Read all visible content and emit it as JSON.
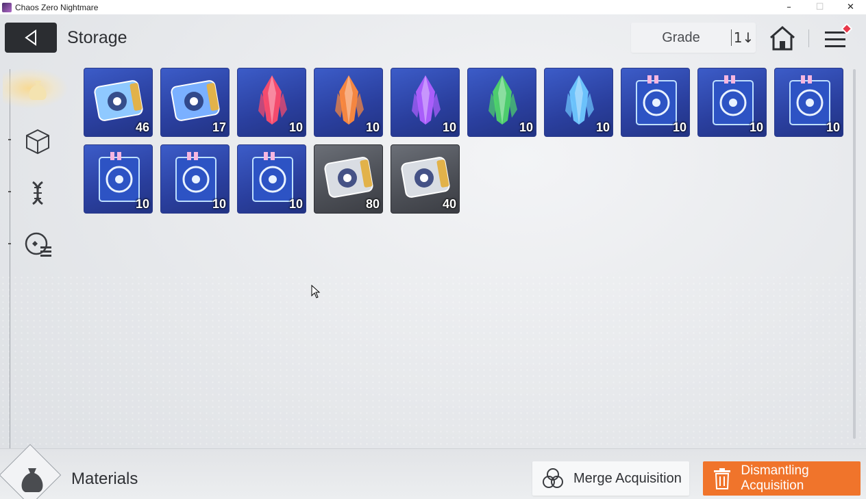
{
  "window": {
    "title": "Chaos Zero Nightmare",
    "controls": [
      "minimize-icon",
      "maximize-icon",
      "close-icon"
    ]
  },
  "header": {
    "title": "Storage",
    "sort_label": "Grade",
    "sort_toggle": "1↓"
  },
  "sidebar": {
    "tabs": [
      {
        "name": "materials",
        "icon": "pouch-icon",
        "active": true
      },
      {
        "name": "cubes",
        "icon": "cube-icon",
        "active": false
      },
      {
        "name": "genes",
        "icon": "dna-icon",
        "active": false
      },
      {
        "name": "memory",
        "icon": "card-list-icon",
        "active": false
      }
    ]
  },
  "items": [
    {
      "icon": "profile-ticket-icon",
      "qty": "46",
      "frame": "blue",
      "color": "#8fc9ff"
    },
    {
      "icon": "compass-ticket-icon",
      "qty": "17",
      "frame": "blue",
      "color": "#7ab0ff"
    },
    {
      "icon": "red-crystal-icon",
      "qty": "10",
      "frame": "blue",
      "color": "#ff4c6a"
    },
    {
      "icon": "orange-crystal-icon",
      "qty": "10",
      "frame": "blue",
      "color": "#ff8a3c"
    },
    {
      "icon": "purple-crystal-icon",
      "qty": "10",
      "frame": "blue",
      "color": "#b060ff"
    },
    {
      "icon": "green-crystal-icon",
      "qty": "10",
      "frame": "blue",
      "color": "#4fd46a"
    },
    {
      "icon": "blue-crystal-icon",
      "qty": "10",
      "frame": "blue",
      "color": "#6fc8ff"
    },
    {
      "icon": "sword-book-icon",
      "qty": "10",
      "frame": "blue",
      "color": "#e9f2ff"
    },
    {
      "icon": "shield-book-icon",
      "qty": "10",
      "frame": "blue",
      "color": "#e9f2ff"
    },
    {
      "icon": "eye-book-icon",
      "qty": "10",
      "frame": "blue",
      "color": "#e9f2ff"
    },
    {
      "icon": "bird-book-icon",
      "qty": "10",
      "frame": "blue",
      "color": "#e9f2ff"
    },
    {
      "icon": "lightning-book-icon",
      "qty": "10",
      "frame": "blue",
      "color": "#e9f2ff"
    },
    {
      "icon": "orb-book-icon",
      "qty": "10",
      "frame": "blue",
      "color": "#e9f2ff"
    },
    {
      "icon": "silver-profile-ticket-icon",
      "qty": "80",
      "frame": "gray",
      "color": "#d9dde3"
    },
    {
      "icon": "silver-compass-ticket-icon",
      "qty": "40",
      "frame": "gray",
      "color": "#d9dde3"
    }
  ],
  "footer": {
    "category_label": "Materials",
    "merge_label": "Merge Acquisition",
    "dismantle_label": "Dismantling Acquisition"
  },
  "colors": {
    "accent": "#f0742b",
    "dark": "#2b2d31",
    "badge": "#e8384a"
  }
}
